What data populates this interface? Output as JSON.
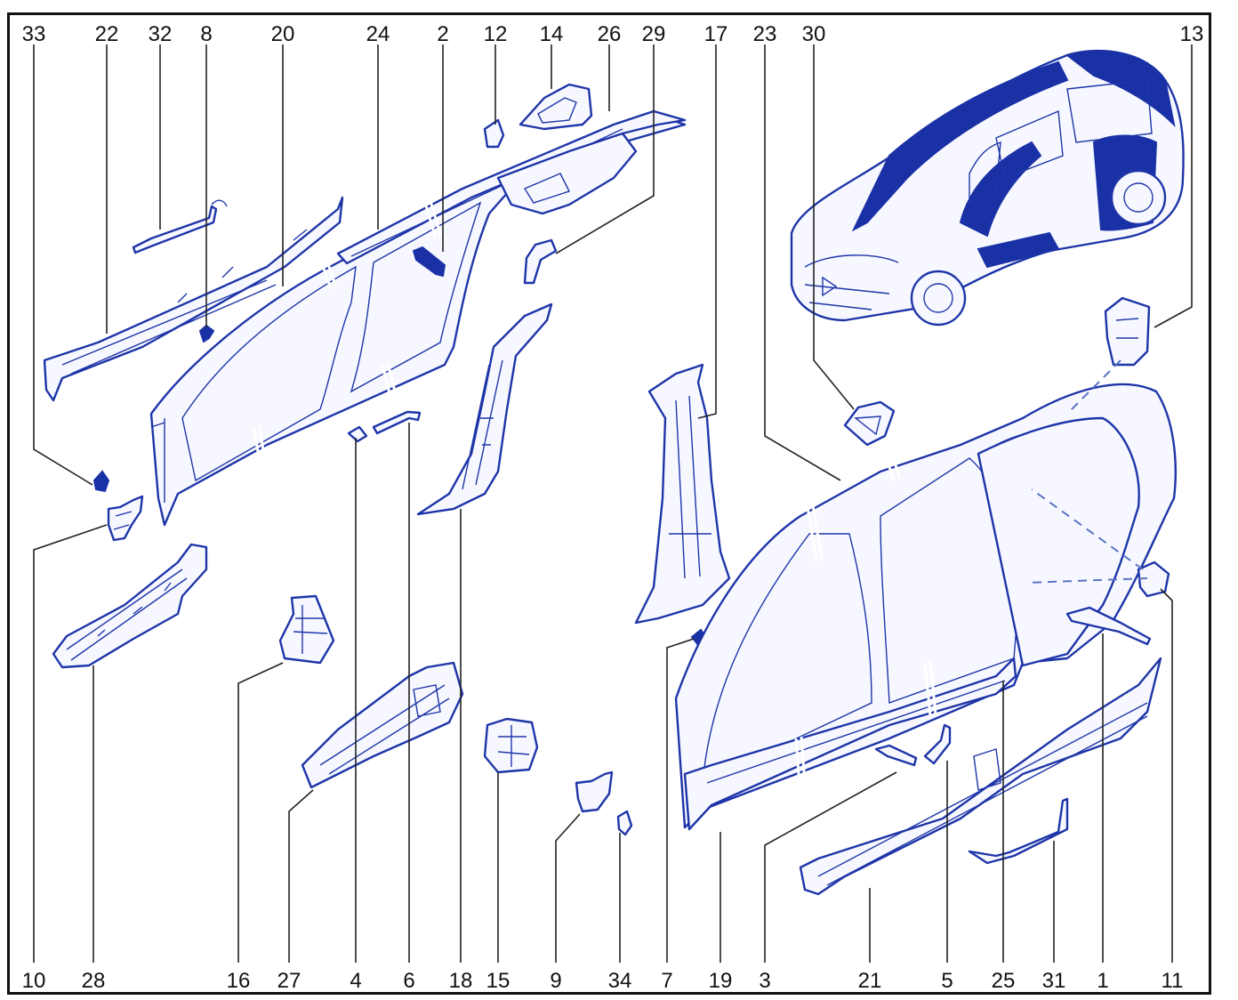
{
  "callouts_top": [
    "33",
    "22",
    "32",
    "8",
    "20",
    "24",
    "2",
    "12",
    "14",
    "26",
    "29",
    "17",
    "23",
    "30",
    "13"
  ],
  "callouts_bottom": [
    "10",
    "28",
    "16",
    "27",
    "4",
    "6",
    "18",
    "15",
    "9",
    "34",
    "7",
    "19",
    "3",
    "21",
    "5",
    "25",
    "31",
    "1",
    "11"
  ],
  "colors": {
    "line_art": "#1e35a8",
    "fill_highlight": "#1a31a6",
    "labels": "#111111"
  }
}
